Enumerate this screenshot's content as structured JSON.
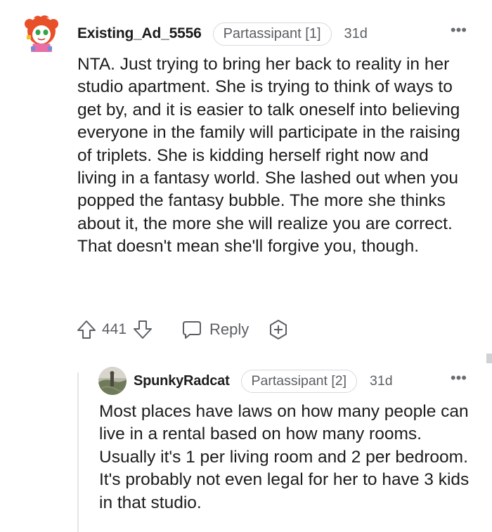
{
  "comments": [
    {
      "username": "Existing_Ad_5556",
      "flair": "Partassipant [1]",
      "time": "31d",
      "more_label": "•••",
      "body": "NTA. Just trying to bring her back to reality in her studio apartment. She is trying to think of ways to get by, and it is easier to talk oneself into believing everyone in the family will participate in the raising of triplets. She is kidding herself right now and living in a fantasy world. She lashed out when you popped the fantasy bubble. The more she thinks about it, the more she will realize you are correct. That doesn't mean she'll forgive you, though.",
      "vote_count": "441",
      "reply_label": "Reply",
      "avatar_icon": "cartoon-avatar-icon"
    },
    {
      "username": "SpunkyRadcat",
      "flair": "Partassipant [2]",
      "time": "31d",
      "more_label": "•••",
      "body": "Most places have laws on how many people can live in a rental based on how many rooms. Usually it's 1 per living room and 2 per bedroom. It's probably not even legal for her to have 3 kids in that studio.",
      "avatar_icon": "photo-avatar-icon"
    }
  ],
  "colors": {
    "text": "#1c1c1c",
    "meta": "#5b5f63",
    "border": "#d7d9db",
    "thread_line": "#e3e5e7"
  }
}
